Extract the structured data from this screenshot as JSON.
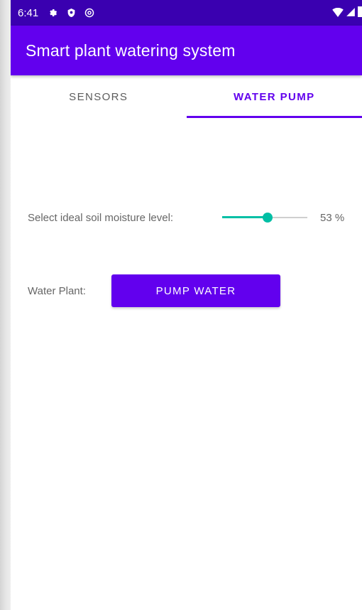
{
  "status_bar": {
    "time": "6:41",
    "icons": [
      "settings-icon",
      "shield-icon",
      "at-sign-icon",
      "wifi-icon",
      "signal-icon",
      "battery-icon"
    ]
  },
  "app_bar": {
    "title": "Smart plant watering system"
  },
  "tabs": [
    {
      "label": "SENSORS",
      "selected": false
    },
    {
      "label": "WATER PUMP",
      "selected": true
    }
  ],
  "moisture": {
    "label": "Select ideal soil moisture level:",
    "value": 53,
    "display": "53 %"
  },
  "water_plant": {
    "label": "Water Plant:",
    "button_label": "PUMP WATER"
  },
  "colors": {
    "status_bar": "#3a00b0",
    "primary": "#6200ee",
    "accent": "#00bfa5"
  }
}
